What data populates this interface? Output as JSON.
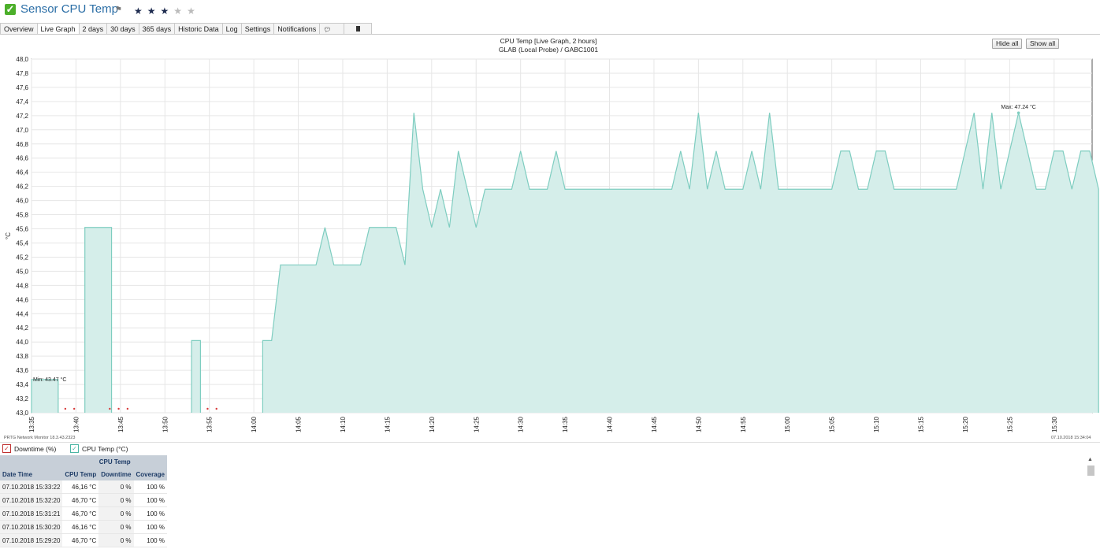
{
  "header": {
    "title": "Sensor CPU Temp",
    "stars_on": [
      "★",
      "★",
      "★"
    ],
    "stars_off": [
      "★",
      "★"
    ]
  },
  "tabs": [
    "Overview",
    "Live Graph",
    "2 days",
    "30 days",
    "365 days",
    "Historic Data",
    "Log",
    "Settings",
    "Notifications",
    "",
    ""
  ],
  "active_tab": "Live Graph",
  "toolbar": {
    "hide_all": "Hide all",
    "show_all": "Show all"
  },
  "footer": {
    "left": "PRTG Network Monitor 18.3.43.2323",
    "right": "07.10.2018 15:34:04"
  },
  "legend": [
    {
      "label": "Downtime (%)",
      "color": "#c0302f"
    },
    {
      "label": "CPU Temp (°C)",
      "color": "#4bb5a4"
    }
  ],
  "chart_data": {
    "type": "area",
    "title": "CPU Temp [Live Graph, 2 hours]",
    "subtitle": "GLAB (Local Probe) / GABC1001",
    "ylabel": "°C",
    "ylim": [
      43.0,
      48.0
    ],
    "yticks": [
      "48,0",
      "47,8",
      "47,6",
      "47,4",
      "47,2",
      "47,0",
      "46,8",
      "46,6",
      "46,4",
      "46,2",
      "46,0",
      "45,8",
      "45,6",
      "45,4",
      "45,2",
      "45,0",
      "44,8",
      "44,6",
      "44,4",
      "44,2",
      "44,0",
      "43,8",
      "43,6",
      "43,4",
      "43,2",
      "43,0"
    ],
    "xticks": [
      "13:35",
      "13:40",
      "13:45",
      "13:50",
      "13:55",
      "14:00",
      "14:05",
      "14:10",
      "14:15",
      "14:20",
      "14:25",
      "14:30",
      "14:35",
      "14:40",
      "14:45",
      "14:50",
      "14:55",
      "15:00",
      "15:05",
      "15:10",
      "15:15",
      "15:20",
      "15:25",
      "15:30"
    ],
    "xrange_minutes": [
      0,
      120
    ],
    "min_label": "Min: 43.47 °C",
    "max_label": "Max: 47.24 °C",
    "series": [
      {
        "name": "CPU Temp (°C)",
        "color": "#4bb5a4",
        "segments": [
          [
            [
              0,
              43.47
            ],
            [
              3,
              43.47
            ]
          ],
          [
            [
              6,
              45.62
            ],
            [
              9,
              45.62
            ]
          ],
          [
            [
              18,
              44.02
            ],
            [
              19,
              44.02
            ]
          ],
          [
            [
              26,
              44.02
            ],
            [
              27,
              44.02
            ],
            [
              28,
              45.09
            ],
            [
              32,
              45.09
            ],
            [
              33,
              45.62
            ],
            [
              34,
              45.09
            ],
            [
              37,
              45.09
            ],
            [
              38,
              45.62
            ],
            [
              41,
              45.62
            ],
            [
              42,
              45.09
            ],
            [
              43,
              47.24
            ],
            [
              44,
              46.16
            ],
            [
              45,
              45.62
            ],
            [
              46,
              46.16
            ],
            [
              47,
              45.62
            ],
            [
              48,
              46.7
            ],
            [
              50,
              45.62
            ],
            [
              51,
              46.16
            ],
            [
              54,
              46.16
            ],
            [
              55,
              46.7
            ],
            [
              56,
              46.16
            ],
            [
              58,
              46.16
            ],
            [
              59,
              46.7
            ],
            [
              60,
              46.16
            ],
            [
              72,
              46.16
            ],
            [
              73,
              46.7
            ],
            [
              74,
              46.16
            ],
            [
              75,
              47.24
            ],
            [
              76,
              46.16
            ],
            [
              77,
              46.7
            ],
            [
              78,
              46.16
            ],
            [
              80,
              46.16
            ],
            [
              81,
              46.7
            ],
            [
              82,
              46.16
            ],
            [
              83,
              47.24
            ],
            [
              84,
              46.16
            ],
            [
              90,
              46.16
            ],
            [
              91,
              46.7
            ],
            [
              92,
              46.7
            ],
            [
              93,
              46.16
            ],
            [
              94,
              46.16
            ],
            [
              95,
              46.7
            ],
            [
              96,
              46.7
            ],
            [
              97,
              46.16
            ],
            [
              104,
              46.16
            ],
            [
              106,
              47.24
            ],
            [
              107,
              46.16
            ],
            [
              108,
              47.24
            ],
            [
              109,
              46.16
            ],
            [
              111,
              47.24
            ],
            [
              113,
              46.16
            ],
            [
              114,
              46.16
            ],
            [
              115,
              46.7
            ],
            [
              116,
              46.7
            ],
            [
              117,
              46.16
            ],
            [
              118,
              46.7
            ],
            [
              119,
              46.7
            ],
            [
              120,
              46.16
            ]
          ]
        ]
      }
    ],
    "downtime_dots_minutes": [
      3.8,
      4.8,
      8.8,
      9.8,
      10.8,
      19.8,
      20.8
    ]
  },
  "table": {
    "group_header": "CPU Temp",
    "columns": [
      "Date Time",
      "CPU Temp",
      "Downtime",
      "Coverage"
    ],
    "rows": [
      [
        "07.10.2018 15:33:22",
        "46,16 °C",
        "0 %",
        "100 %"
      ],
      [
        "07.10.2018 15:32:20",
        "46,70 °C",
        "0 %",
        "100 %"
      ],
      [
        "07.10.2018 15:31:21",
        "46,70 °C",
        "0 %",
        "100 %"
      ],
      [
        "07.10.2018 15:30:20",
        "46,16 °C",
        "0 %",
        "100 %"
      ],
      [
        "07.10.2018 15:29:20",
        "46,70 °C",
        "0 %",
        "100 %"
      ]
    ]
  },
  "colors": {
    "accent": "#2b6ea6",
    "area_fill": "#d5eeea",
    "area_line": "#7ecdc0",
    "downtime": "#d83a3a"
  }
}
